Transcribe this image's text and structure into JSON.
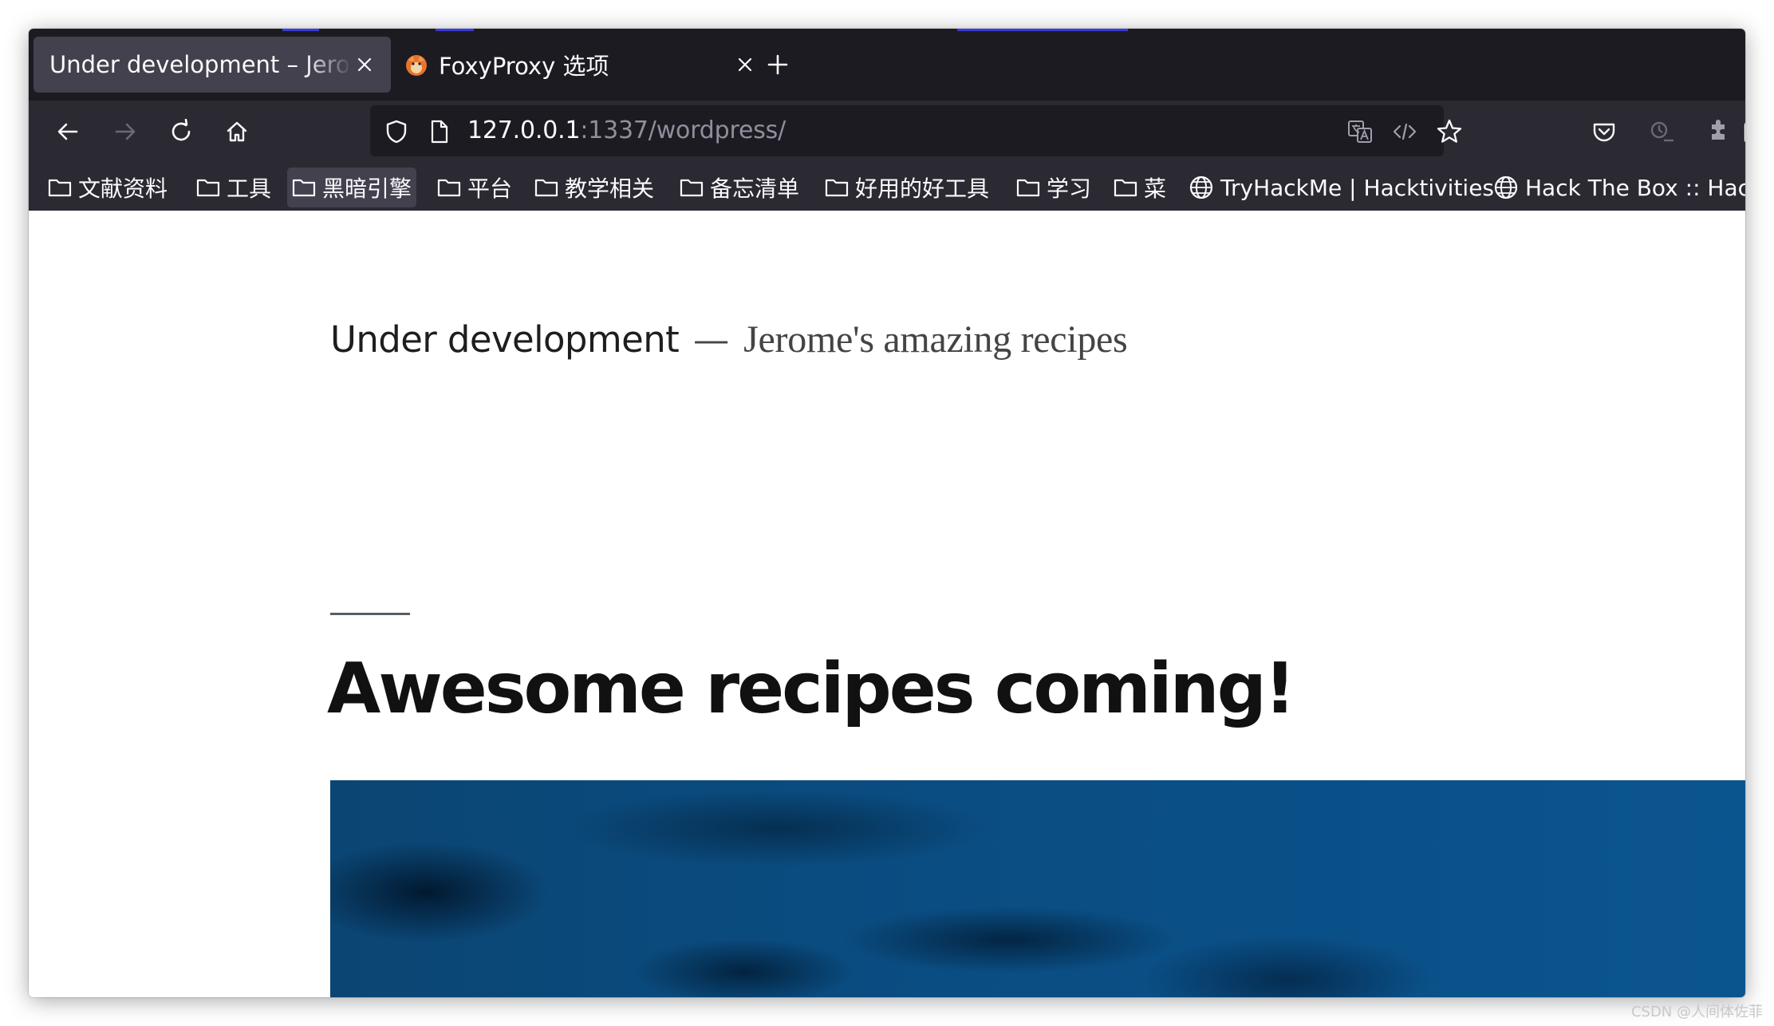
{
  "tabs": [
    {
      "title": "Under development – Jerome's amazing recipes",
      "active": true
    },
    {
      "title": "FoxyProxy 选项",
      "active": false
    }
  ],
  "nav": {
    "url_host": "127.0.0.1",
    "url_path": ":1337/wordpress/"
  },
  "bookmarks": [
    {
      "label": "文献资料",
      "icon": "folder-icon"
    },
    {
      "label": "工具",
      "icon": "folder-icon"
    },
    {
      "label": "黑暗引擎",
      "icon": "folder-icon"
    },
    {
      "label": "平台",
      "icon": "folder-icon"
    },
    {
      "label": "教学相关",
      "icon": "folder-icon"
    },
    {
      "label": "备忘清单",
      "icon": "folder-icon"
    },
    {
      "label": "好用的好工具",
      "icon": "folder-icon"
    },
    {
      "label": "学习",
      "icon": "folder-icon"
    },
    {
      "label": "菜",
      "icon": "folder-icon"
    },
    {
      "label": "TryHackMe | Hacktivities",
      "icon": "globe-icon"
    },
    {
      "label": "Hack The Box :: Hack The Box",
      "icon": "globe-icon"
    }
  ],
  "page": {
    "site_title": "Under development",
    "site_separator": "—",
    "site_description": "Jerome's amazing recipes",
    "post_title": "Awesome recipes coming!"
  },
  "watermark": "CSDN @人间体佐菲",
  "colors": {
    "tabbar_bg": "#1c1b22",
    "toolbar_bg": "#2b2a33",
    "active_tab": "#42414d",
    "hero_blue": "#0a5088"
  }
}
